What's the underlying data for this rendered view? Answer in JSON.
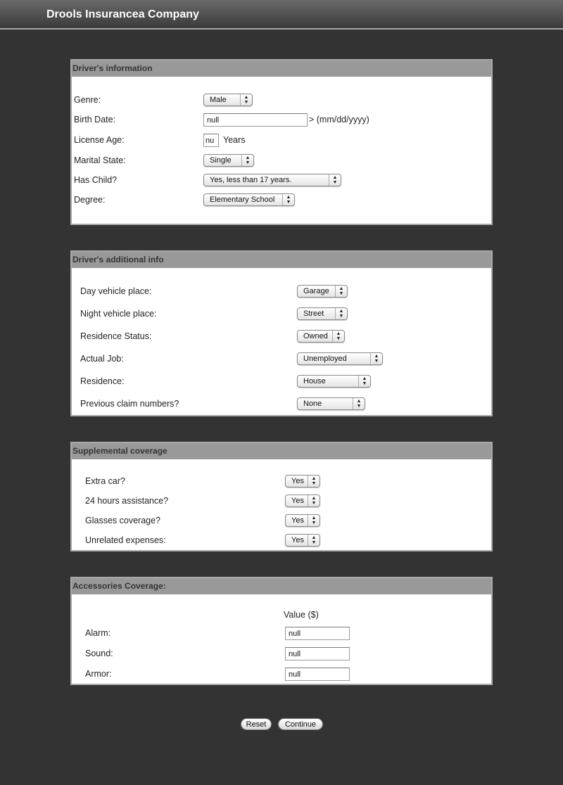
{
  "app": {
    "title": "Drools Insurancea Company"
  },
  "driver": {
    "title": "Driver's information",
    "genre": {
      "label": "Genre:",
      "value": "Male"
    },
    "birth": {
      "label": "Birth Date:",
      "value": "null",
      "hint": "> (mm/dd/yyyy)"
    },
    "license": {
      "label": "License Age:",
      "value": "nu",
      "unit": "Years"
    },
    "marital": {
      "label": "Marital State:",
      "value": "Single"
    },
    "child": {
      "label": "Has Child?",
      "value": "Yes, less than 17 years."
    },
    "degree": {
      "label": "Degree:",
      "value": "Elementary School"
    }
  },
  "additional": {
    "title": "Driver's additional info",
    "rows": [
      {
        "label": "Day vehicle place:",
        "value": "Garage"
      },
      {
        "label": "Night vehicle place:",
        "value": "Street"
      },
      {
        "label": "Residence Status:",
        "value": "Owned"
      },
      {
        "label": "Actual Job:",
        "value": "Unemployed"
      },
      {
        "label": "Residence:",
        "value": "House"
      },
      {
        "label": "Previous claim numbers?",
        "value": "None"
      }
    ]
  },
  "supplemental": {
    "title": "Supplemental coverage",
    "rows": [
      {
        "label": "Extra car?",
        "value": "Yes"
      },
      {
        "label": "24 hours assistance?",
        "value": "Yes"
      },
      {
        "label": "Glasses coverage?",
        "value": "Yes"
      },
      {
        "label": "Unrelated expenses:",
        "value": "Yes"
      }
    ]
  },
  "accessories": {
    "title": "Accessories Coverage:",
    "value_header": "Value ($)",
    "rows": [
      {
        "label": "Alarm:",
        "value": "null"
      },
      {
        "label": "Sound:",
        "value": "null"
      },
      {
        "label": "Armor:",
        "value": "null"
      }
    ]
  },
  "buttons": {
    "reset": "Reset",
    "continue": "Continue"
  }
}
